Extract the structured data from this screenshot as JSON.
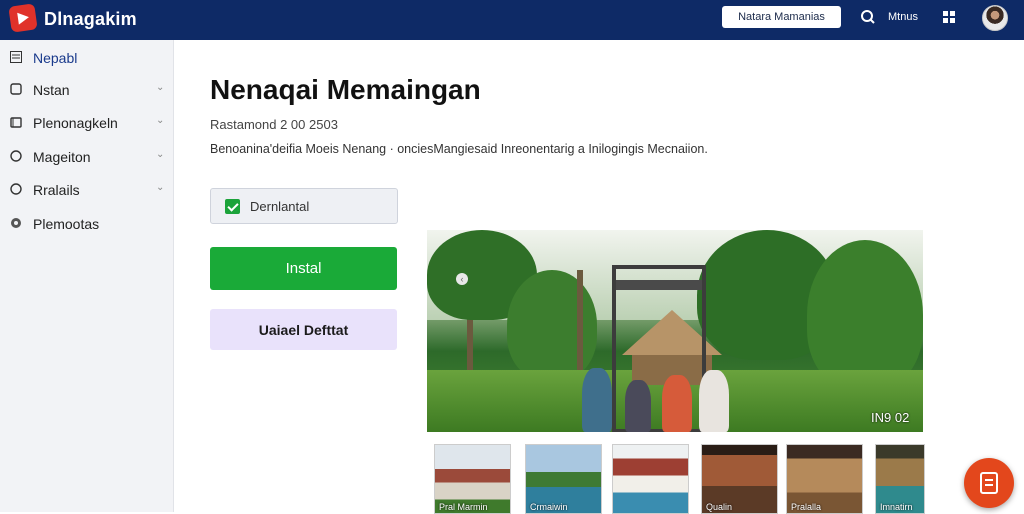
{
  "header": {
    "app_title": "Dlnagakim",
    "action_button": "Natara Mamanias",
    "link_label": "Mtnus",
    "icons": [
      "logo-icon",
      "search-icon",
      "grid-icon"
    ]
  },
  "sidebar": {
    "items": [
      {
        "label": "Nepabl",
        "icon": "list-icon",
        "chevron": false,
        "active": true
      },
      {
        "label": "Nstan",
        "icon": "square-icon",
        "chevron": true
      },
      {
        "label": "Plenonagkeln",
        "icon": "folder-icon",
        "chevron": true
      },
      {
        "label": "Mageiton",
        "icon": "circle-icon",
        "chevron": true
      },
      {
        "label": "Rralails",
        "icon": "circle-icon",
        "chevron": true
      },
      {
        "label": "Plemootas",
        "icon": "gear-icon",
        "chevron": false
      }
    ]
  },
  "main": {
    "title": "Nenaqai Memaingan",
    "date": "Rastamond 2 00 2503",
    "description": "Benoanina'deifia Moeis Nenang · onciesMangiesaid Inreonentarig a Inilogingis Mecnaiion.",
    "checkbox_label": "Dernlantal",
    "primary_button": "Instal",
    "secondary_button": "Uaiael Defttat",
    "image_caption": "IN9 02",
    "thumbnails": [
      {
        "label": "Pral Marmin"
      },
      {
        "label": "Crmaiwin"
      },
      {
        "label": ""
      },
      {
        "label": "Qualin"
      },
      {
        "label": "Pralalla"
      },
      {
        "label": "Imnatirn"
      }
    ]
  },
  "colors": {
    "header_bg": "#0e2a66",
    "primary_green": "#1aaa38",
    "secondary_lavender": "#e9e2fb",
    "fab_orange": "#e3471c",
    "logo_red": "#e0322a"
  }
}
